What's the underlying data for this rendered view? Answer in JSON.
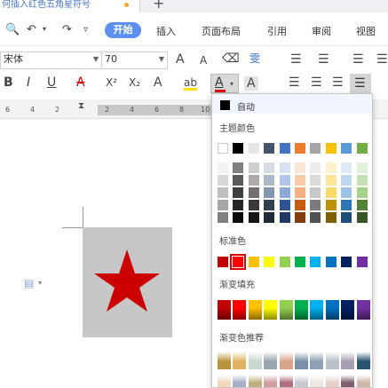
{
  "titlebar": {
    "doc_title": "何插入红色五角星符号",
    "new_tab": "+"
  },
  "toolbar_icons": {
    "dot": "•"
  },
  "tabs": {
    "active": "开始",
    "items": [
      "插入",
      "页面布局",
      "引用",
      "审阅",
      "视图"
    ]
  },
  "font": {
    "name": "宋体",
    "size": "70"
  },
  "format_glyphs": {
    "bold": "B",
    "italic": "I",
    "underline": "U",
    "strike": "A",
    "superscript": "X²",
    "subscript": "X₂",
    "font_color_letter": "A",
    "char_shading": "A",
    "grow": "A",
    "shrink": "A",
    "highlight": "ab"
  },
  "ruler": {
    "left_numbers": [
      "6",
      "4",
      "2"
    ],
    "right_numbers": [
      "2",
      "4",
      "6",
      "8",
      "10"
    ]
  },
  "panel": {
    "auto_label": "自动",
    "theme_label": "主题颜色",
    "standard_label": "标准色",
    "gradient_label": "渐变填充",
    "gradient_rec_label": "渐变色推荐"
  },
  "theme_colors": {
    "top": [
      "#ffffff",
      "#000000",
      "#e7e6e6",
      "#44546a",
      "#4472c4",
      "#ed7d31",
      "#a5a5a5",
      "#ffc000",
      "#5b9bd5",
      "#70ad47"
    ],
    "shades": [
      [
        "#f2f2f2",
        "#7f7f7f",
        "#d0cece",
        "#d6dce4",
        "#d9e2f3",
        "#fbe5d5",
        "#ededed",
        "#fff2cc",
        "#deebf6",
        "#e2efd9"
      ],
      [
        "#d8d8d8",
        "#595959",
        "#aeaaaa",
        "#adb9ca",
        "#b4c6e7",
        "#f7cbac",
        "#dbdbdb",
        "#fee599",
        "#bdd7ee",
        "#c5e0b3"
      ],
      [
        "#bfbfbf",
        "#3f3f3f",
        "#757070",
        "#8496b0",
        "#8eaadb",
        "#f4b183",
        "#c9c9c9",
        "#ffd965",
        "#9cc3e5",
        "#a8d08d"
      ],
      [
        "#a5a5a5",
        "#262626",
        "#3a3838",
        "#323f4f",
        "#2f5496",
        "#c55a11",
        "#7b7b7b",
        "#bf9000",
        "#2e75b5",
        "#538135"
      ],
      [
        "#7f7f7f",
        "#0c0c0c",
        "#171616",
        "#222a35",
        "#1f3864",
        "#833c0b",
        "#525252",
        "#7f6000",
        "#1e4e79",
        "#375623"
      ]
    ]
  },
  "standard_colors": [
    "#c00000",
    "#ff0000",
    "#ffc000",
    "#ffff00",
    "#92d050",
    "#00b050",
    "#00b0f0",
    "#0070c0",
    "#002060",
    "#7030a0"
  ],
  "gradient_fill": [
    "#c00000",
    "#ff0000",
    "#ffc000",
    "#ffff00",
    "#92d050",
    "#00b050",
    "#00b0f0",
    "#0070c0",
    "#002060",
    "#7030a0"
  ],
  "gradient_recommend": [
    [
      "#b8963c",
      "#e0b460",
      "#c8d8d0",
      "#9aa6b0",
      "#d9a48c",
      "#7890a8",
      "#8ea0b4",
      "#b8c0c8",
      "#a8a0b0",
      "#2a5470"
    ],
    [
      "#f0d8c0",
      "#a8b0c8",
      "#c0b080",
      "#d0a0a0",
      "#b07080",
      "#c8c8d0",
      "#f0e8e0",
      "#e8d0c8",
      "#806070",
      "#d0b8a8"
    ]
  ],
  "colors": {
    "star": "#cc0000",
    "active_tab": "#5b8ff0",
    "selection_outline": "#dd0000"
  },
  "icons": {
    "star": "star-icon",
    "doc_page": "document-icon"
  }
}
